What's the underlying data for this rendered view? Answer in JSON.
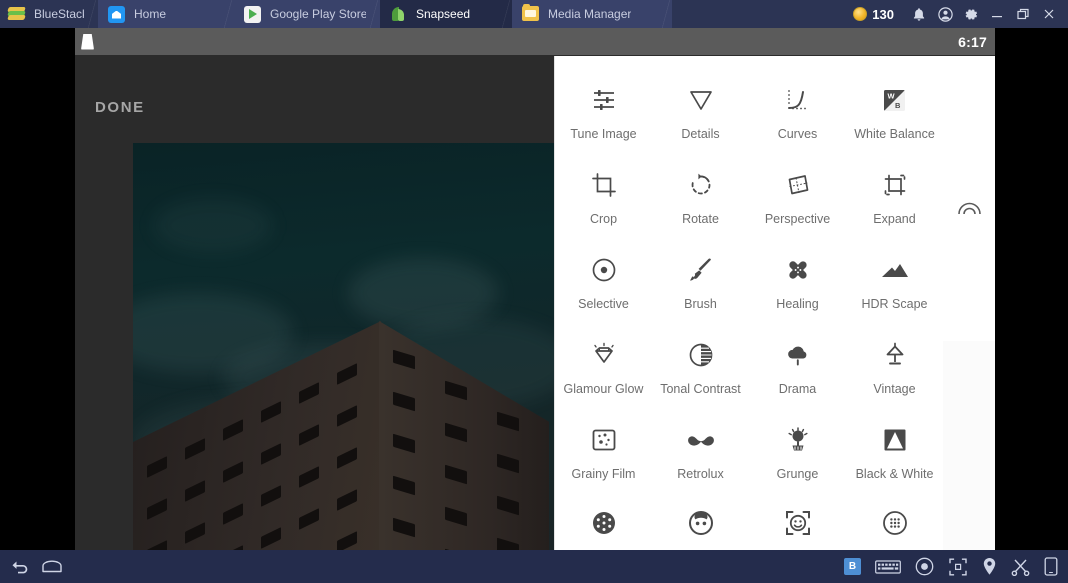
{
  "titlebar": {
    "tabs": [
      {
        "label": "BlueStacks",
        "icon": "bluestacks-logo-icon",
        "active": false,
        "brand": true,
        "width": 98
      },
      {
        "label": "Home",
        "icon": "home-icon",
        "active": false,
        "brand": false,
        "width": 136
      },
      {
        "label": "Google Play Store",
        "icon": "google-play-icon",
        "active": false,
        "brand": false,
        "width": 146
      },
      {
        "label": "Snapseed",
        "icon": "snapseed-leaf-icon",
        "active": true,
        "brand": false,
        "width": 132
      },
      {
        "label": "Media Manager",
        "icon": "folder-icon",
        "active": false,
        "brand": false,
        "width": 160
      }
    ],
    "coins": {
      "value": "130",
      "icon": "coin-icon"
    },
    "controls": [
      {
        "name": "notifications-bell-icon",
        "glyph": "bell"
      },
      {
        "name": "account-icon",
        "glyph": "account"
      },
      {
        "name": "settings-gear-icon",
        "glyph": "gear"
      },
      {
        "name": "minimize-button",
        "glyph": "minimize"
      },
      {
        "name": "restore-button",
        "glyph": "restore"
      },
      {
        "name": "close-button",
        "glyph": "close"
      }
    ]
  },
  "android": {
    "statusbar": {
      "doc_icon": "document-icon",
      "clock": "6:17"
    }
  },
  "editor": {
    "done_label": "DONE",
    "photo_alt": "night-photo-of-building-corner-against-dark-teal-sky"
  },
  "tools_panel": {
    "tools": [
      {
        "label": "Tune Image",
        "icon": "sliders-icon",
        "cut": false
      },
      {
        "label": "Details",
        "icon": "triangle-down-icon",
        "cut": false
      },
      {
        "label": "Curves",
        "icon": "curves-icon",
        "cut": false
      },
      {
        "label": "White Balance",
        "icon": "white-balance-icon",
        "cut": false
      },
      {
        "label": "Crop",
        "icon": "crop-icon",
        "cut": false
      },
      {
        "label": "Rotate",
        "icon": "rotate-icon",
        "cut": false
      },
      {
        "label": "Perspective",
        "icon": "perspective-icon",
        "cut": false
      },
      {
        "label": "Expand",
        "icon": "expand-icon",
        "cut": false
      },
      {
        "label": "Selective",
        "icon": "selective-dot-icon",
        "cut": false
      },
      {
        "label": "Brush",
        "icon": "brush-icon",
        "cut": false
      },
      {
        "label": "Healing",
        "icon": "healing-bandage-icon",
        "cut": false
      },
      {
        "label": "HDR Scape",
        "icon": "mountains-icon",
        "cut": false
      },
      {
        "label": "Glamour Glow",
        "icon": "glamour-glow-icon",
        "cut": false
      },
      {
        "label": "Tonal Contrast",
        "icon": "tonal-contrast-icon",
        "cut": false
      },
      {
        "label": "Drama",
        "icon": "cloud-rain-icon",
        "cut": false
      },
      {
        "label": "Vintage",
        "icon": "lamp-icon",
        "cut": false
      },
      {
        "label": "Grainy Film",
        "icon": "grainy-film-icon",
        "cut": false
      },
      {
        "label": "Retrolux",
        "icon": "mustache-icon",
        "cut": false
      },
      {
        "label": "Grunge",
        "icon": "grunge-icon",
        "cut": false
      },
      {
        "label": "Black & White",
        "icon": "black-white-icon",
        "cut": false
      },
      {
        "label": "",
        "icon": "lens-blur-icon",
        "cut": true
      },
      {
        "label": "",
        "icon": "portrait-icon",
        "cut": true
      },
      {
        "label": "",
        "icon": "face-detect-icon",
        "cut": true
      },
      {
        "label": "",
        "icon": "head-pose-icon",
        "cut": true
      }
    ]
  },
  "rail": {
    "arc_icon": "arc-icon",
    "cursor_icon": "blue-pen-cursor"
  },
  "bottombar": {
    "left": [
      {
        "name": "back-button",
        "glyph": "back"
      },
      {
        "name": "home-button",
        "glyph": "home"
      }
    ],
    "right": [
      {
        "name": "app-badge-icon",
        "glyph": "app",
        "label": "B"
      },
      {
        "name": "keyboard-icon",
        "glyph": "keyboard"
      },
      {
        "name": "record-icon",
        "glyph": "record"
      },
      {
        "name": "fullscreen-icon",
        "glyph": "fullscreen"
      },
      {
        "name": "location-pin-icon",
        "glyph": "pin"
      },
      {
        "name": "scissors-icon",
        "glyph": "scissors"
      },
      {
        "name": "phone-icon",
        "glyph": "phone"
      }
    ]
  },
  "colors": {
    "titlebar_bg": "#2c3454",
    "tab_bg": "#39426a",
    "tab_active_bg": "#232a47",
    "android_status_bg": "#5b5b5b",
    "editor_bg": "#2b2b2b",
    "panel_bg": "#ffffff",
    "bottombar_bg": "#242c4c",
    "accent_blue": "#4e8fd4",
    "coin_gold": "#f2b62b"
  }
}
